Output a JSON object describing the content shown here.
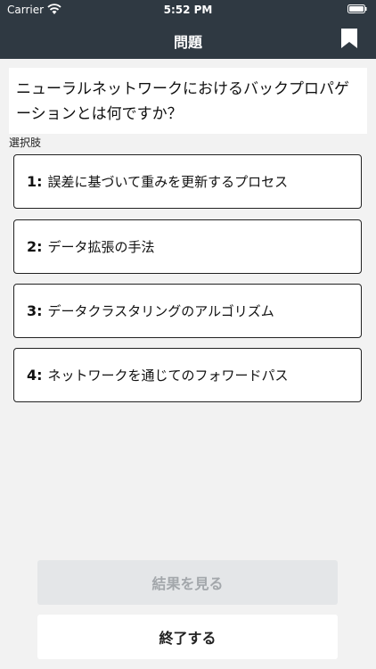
{
  "status_bar": {
    "carrier": "Carrier",
    "time": "5:52 PM"
  },
  "nav": {
    "title": "問題",
    "bookmark_icon": "bookmark-icon"
  },
  "question": {
    "text": "ニューラルネットワークにおけるバックプロパゲーションとは何ですか？"
  },
  "choices_label": "選択肢",
  "choices": [
    {
      "num": "1:",
      "text": "誤差に基づいて重みを更新するプロセス"
    },
    {
      "num": "2:",
      "text": "データ拡張の手法"
    },
    {
      "num": "3:",
      "text": "データクラスタリングのアルゴリズム"
    },
    {
      "num": "4:",
      "text": "ネットワークを通じてのフォワードパス"
    }
  ],
  "buttons": {
    "show_result": "結果を見る",
    "finish": "終了する"
  },
  "colors": {
    "header_bg": "#2f3942",
    "page_bg": "#f2f2f2",
    "disabled_text": "#a3a7ab"
  }
}
